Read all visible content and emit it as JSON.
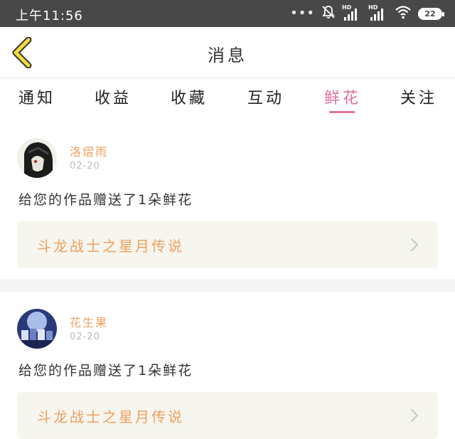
{
  "status_bar": {
    "time": "上午11:56",
    "hd1": "HD",
    "hd2": "HD",
    "battery": "22",
    "icons": [
      "more-dots-icon",
      "bell-off-icon",
      "signal-icon",
      "signal-icon",
      "wifi-icon",
      "battery-icon"
    ]
  },
  "header": {
    "title": "消息",
    "back_icon": "chevron-left-icon",
    "accent": "#f2dc3a"
  },
  "tabs": [
    {
      "label": "通知",
      "active": false
    },
    {
      "label": "收益",
      "active": false
    },
    {
      "label": "收藏",
      "active": false
    },
    {
      "label": "互动",
      "active": false
    },
    {
      "label": "鲜花",
      "active": true
    },
    {
      "label": "关注",
      "active": false
    }
  ],
  "active_color": "#e070a0",
  "messages": [
    {
      "user": "洛熠雨",
      "date": "02-20",
      "text": "给您的作品赠送了1朵鲜花",
      "work_title": "斗龙战士之星月传说"
    },
    {
      "user": "花生果",
      "date": "02-20",
      "text": "给您的作品赠送了1朵鲜花",
      "work_title": "斗龙战士之星月传说"
    }
  ]
}
